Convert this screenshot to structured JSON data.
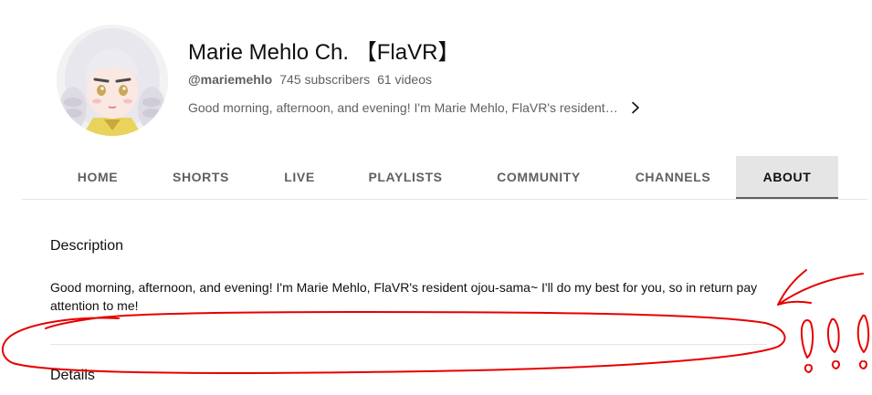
{
  "channel": {
    "name": "Marie Mehlo Ch. 【FlaVR】",
    "handle": "@mariemehlo",
    "subscribers": "745 subscribers",
    "videos": "61 videos",
    "tagline": "Good morning, afternoon, and evening! I'm Marie Mehlo, FlaVR's resident ojou-sama~ I'll do my best for you, so in return pay attention to me!"
  },
  "tabs": [
    {
      "label": "HOME",
      "active": false
    },
    {
      "label": "SHORTS",
      "active": false
    },
    {
      "label": "LIVE",
      "active": false
    },
    {
      "label": "PLAYLISTS",
      "active": false
    },
    {
      "label": "COMMUNITY",
      "active": false
    },
    {
      "label": "CHANNELS",
      "active": false
    },
    {
      "label": "ABOUT",
      "active": true
    }
  ],
  "about": {
    "description_heading": "Description",
    "description_text": "Good morning, afternoon, and evening! I'm Marie Mehlo, FlaVR's resident ojou-sama~ I'll do my best for you, so in return pay attention to me!",
    "details_heading": "Details"
  },
  "icons": {
    "avatar": "channel-avatar",
    "more": "chevron-right-icon"
  },
  "colors": {
    "active_tab_bg": "#e5e5e5",
    "secondary_text": "#606060",
    "annotation": "#e60000"
  }
}
